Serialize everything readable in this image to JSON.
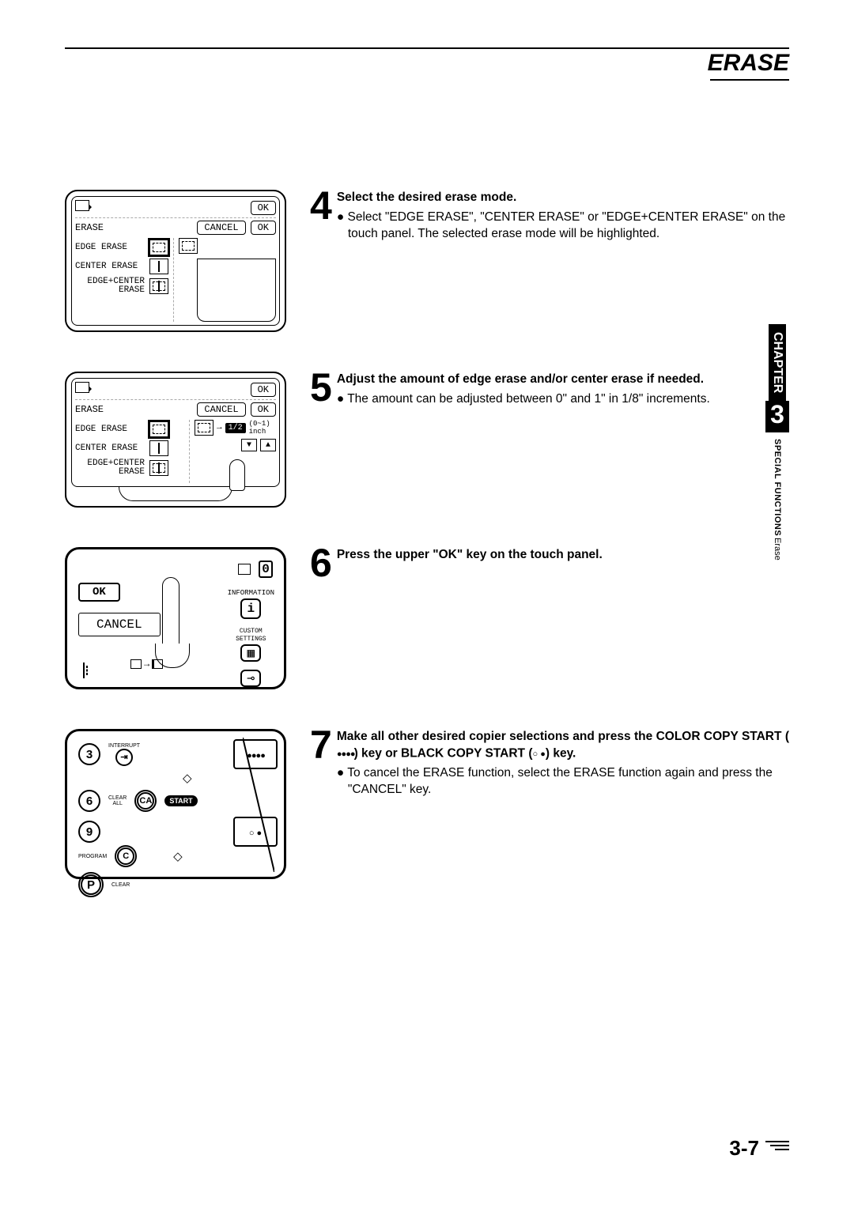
{
  "header": {
    "title": "ERASE"
  },
  "panel": {
    "erase_label": "ERASE",
    "ok": "OK",
    "cancel": "CANCEL",
    "edge_erase": "EDGE ERASE",
    "center_erase": "CENTER ERASE",
    "edge_center_erase_l1": "EDGE+CENTER",
    "edge_center_erase_l2": "ERASE",
    "amount_value": "1/2",
    "amount_range": "(0~1)",
    "amount_unit": "inch"
  },
  "panelC": {
    "ok": "OK",
    "cancel": "CANCEL",
    "information": "INFORMATION",
    "info_symbol": "i",
    "custom_settings_l1": "CUSTOM",
    "custom_settings_l2": "SETTINGS"
  },
  "panelD": {
    "k3": "3",
    "k6": "6",
    "k9": "9",
    "interrupt": "INTERRUPT",
    "clear_all": "CLEAR\nALL",
    "ca": "CA",
    "start": "START",
    "program": "PROGRAM",
    "c": "C",
    "p": "P",
    "clear": "CLEAR"
  },
  "steps": {
    "s4": {
      "num": "4",
      "heading": "Select the desired erase mode.",
      "p1": "Select \"EDGE ERASE\", \"CENTER ERASE\" or \"EDGE+CENTER ERASE\" on the touch panel. The selected erase mode will be highlighted."
    },
    "s5": {
      "num": "5",
      "heading": "Adjust the amount of edge erase and/or center erase if needed.",
      "p1": "The amount can be adjusted between 0\" and 1\" in 1/8\" increments."
    },
    "s6": {
      "num": "6",
      "heading": "Press the upper \"OK\" key on the touch panel."
    },
    "s7": {
      "num": "7",
      "heading_a": "Make all other desired copier selections and press the COLOR COPY START (",
      "heading_b": ") key or BLACK COPY START (",
      "heading_c": ") key.",
      "p1": "To cancel the ERASE function, select the ERASE function again and press the \"CANCEL\" key."
    }
  },
  "sidebar": {
    "chapter": "CHAPTER",
    "chapter_num": "3",
    "section": "SPECIAL FUNCTIONS",
    "topic": "Erase"
  },
  "footer": {
    "page": "3-7"
  }
}
